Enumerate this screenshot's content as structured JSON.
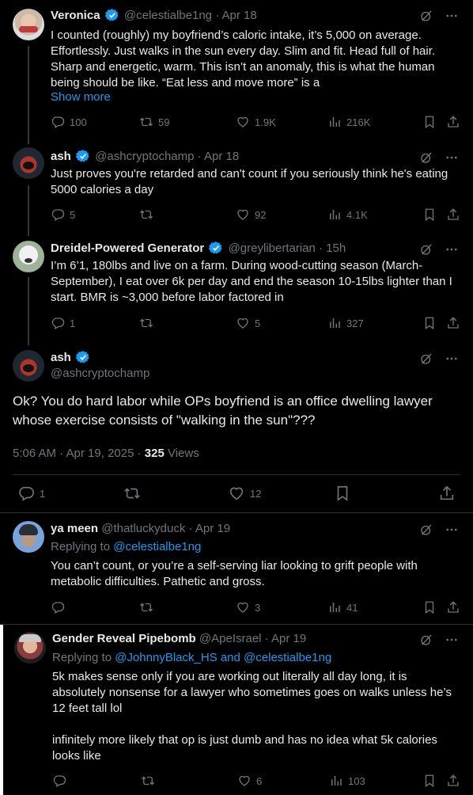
{
  "tweets": [
    {
      "name": "Veronica",
      "handle": "@celestialbe1ng",
      "time": "Apr 18",
      "text": "I counted (roughly) my boyfriend’s caloric intake, it’s 5,000 on average. Effortlessly. Just walks in the sun every day. Slim and fit. Head full of hair. Sharp and energetic, warm. This isn’t an anomaly, this is what the human being should be like. “Eat less and move more” is a",
      "show_more": "Show more",
      "replies": "100",
      "reposts": "59",
      "likes": "1.9K",
      "views": "216K"
    },
    {
      "name": "ash",
      "handle": "@ashcryptochamp",
      "time": "Apr 18",
      "text": "Just proves you're retarded and can't count if you seriously think he's eating 5000 calories a day",
      "replies": "5",
      "reposts": "",
      "likes": "92",
      "views": "4.1K"
    },
    {
      "name": "Dreidel-Powered Generator",
      "handle": "@greylibertarian",
      "time": "15h",
      "text": "I’m 6’1, 180lbs and live on a farm. During wood-cutting season (March-September), I eat over 6k per day and end the season 10-15lbs lighter than I start. BMR is ~3,000 before labor factored in",
      "replies": "1",
      "reposts": "",
      "likes": "5",
      "views": "327"
    }
  ],
  "main": {
    "name": "ash",
    "handle": "@ashcryptochamp",
    "text": "Ok? You do hard labor while OPs boyfriend is an office dwelling lawyer whose exercise consists of \"walking in the sun\"???",
    "timestamp": "5:06 AM · Apr 19, 2025 · ",
    "views_count": "325",
    "views_label": " Views",
    "replies": "1",
    "likes": "12"
  },
  "replies": [
    {
      "name": "ya meen",
      "handle": "@thatluckyduck",
      "time": "Apr 19",
      "replying_prefix": "Replying to ",
      "replying_to": "@celestialbe1ng",
      "text": "You can’t count, or you’re a self-serving liar looking to grift people with metabolic difficulties. Pathetic and gross.",
      "replies": "",
      "reposts": "",
      "likes": "3",
      "views": "41"
    },
    {
      "name": "Gender Reveal Pipebomb",
      "handle": "@ApeIsrael",
      "time": "Apr 19",
      "replying_prefix": "Replying to ",
      "replying_to": "@JohnnyBlack_HS and @celestialbe1ng",
      "text1": "5k makes sense only if you are working out literally all day long, it is absolutely nonsense for a lawyer who sometimes goes on walks unless he’s 12 feet tall lol",
      "text2": "infinitely more likely that op is just dumb and has no idea what 5k calories looks like",
      "replies": "",
      "reposts": "",
      "likes": "6",
      "views": "103"
    }
  ],
  "sep": " · ",
  "colors": {
    "accent": "#1d9bf0",
    "secondary_text": "#71767b",
    "background": "#000000"
  },
  "icons": [
    "verified-badge-icon",
    "grok-icon",
    "more-icon",
    "reply-icon",
    "repost-icon",
    "like-icon",
    "views-icon",
    "bookmark-icon",
    "share-icon"
  ]
}
